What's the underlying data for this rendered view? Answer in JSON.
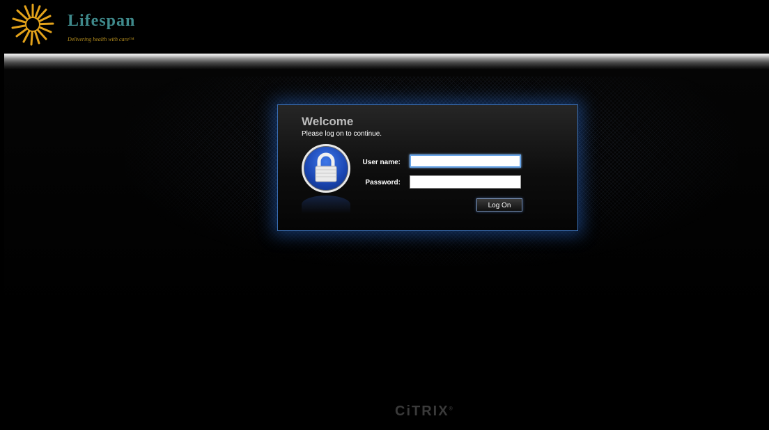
{
  "brand": {
    "name": "Lifespan",
    "tagline": "Delivering health with care™"
  },
  "login": {
    "title": "Welcome",
    "subtitle": "Please log on to continue.",
    "username_label": "User name:",
    "username_value": "",
    "password_label": "Password:",
    "password_value": "",
    "submit_label": "Log On"
  },
  "footer": {
    "vendor": "CiTRIX",
    "vendor_mark": "®"
  },
  "colors": {
    "brand_teal": "#3f8a8c",
    "brand_gold": "#e3a21a",
    "panel_glow": "#2a6ed8",
    "lock_blue": "#1b47b4"
  },
  "icons": {
    "logo": "sunburst-logo",
    "lock": "padlock-icon"
  }
}
